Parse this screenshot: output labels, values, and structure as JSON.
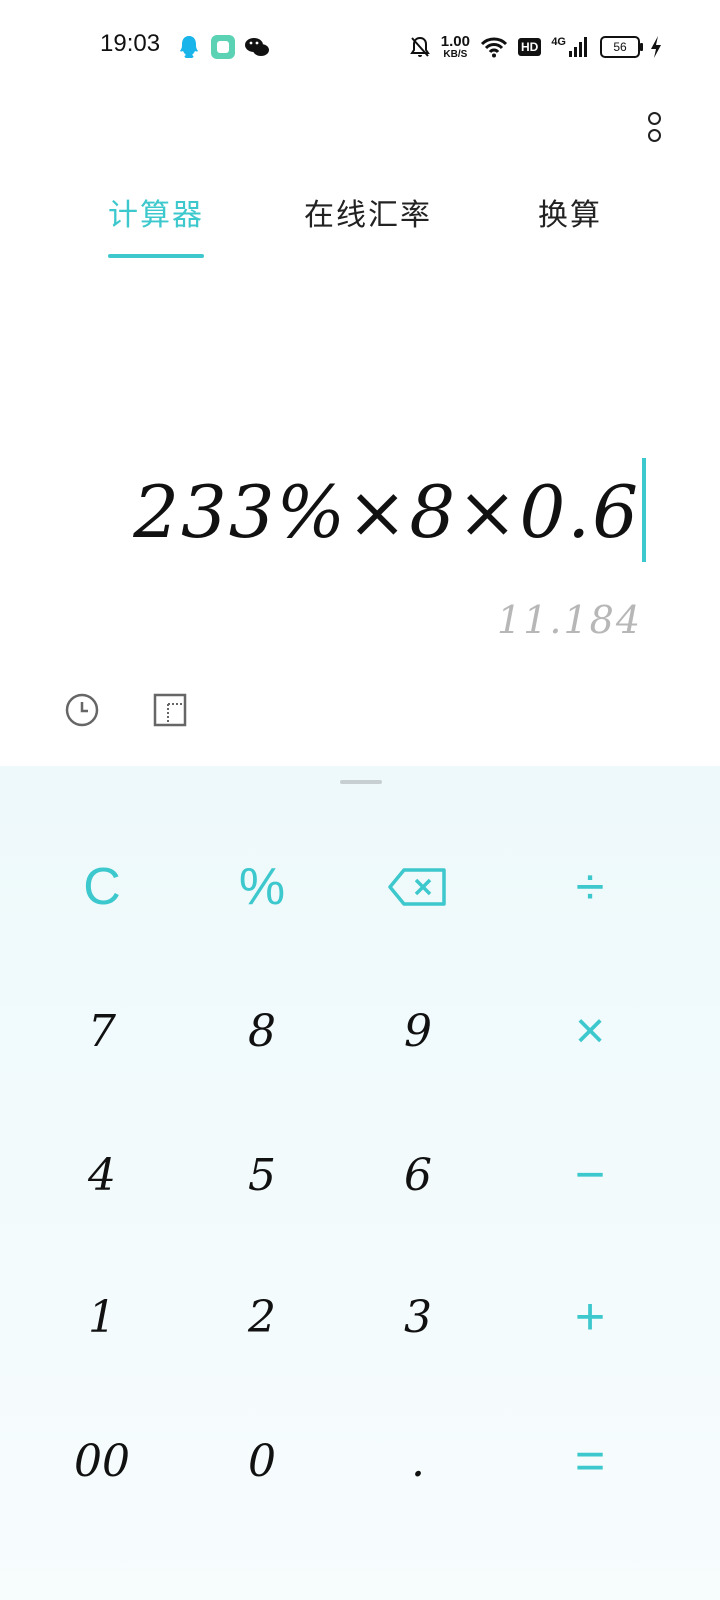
{
  "status_bar": {
    "time": "19:03",
    "network_speed_value": "1.00",
    "network_speed_unit": "KB/S",
    "hd_label": "HD",
    "network_type": "4G",
    "battery_level": "56"
  },
  "tabs": [
    {
      "label": "计算器",
      "active": true
    },
    {
      "label": "在线汇率",
      "active": false
    },
    {
      "label": "换算",
      "active": false
    }
  ],
  "display": {
    "expression": "233%×8×0.6",
    "result": "11.184"
  },
  "keypad": {
    "row1": [
      "C",
      "%",
      "⌫",
      "÷"
    ],
    "row2": [
      "7",
      "8",
      "9",
      "×"
    ],
    "row3": [
      "4",
      "5",
      "6",
      "−"
    ],
    "row4": [
      "1",
      "2",
      "3",
      "+"
    ],
    "row5": [
      "00",
      "0",
      ".",
      "="
    ]
  },
  "colors": {
    "accent": "#3cc8cc",
    "result_text": "#b7b7b7",
    "keypad_bg": "#eef9fb"
  },
  "icons": {
    "status_apps": [
      "qq-icon",
      "app-icon",
      "wechat-icon"
    ],
    "status_right": [
      "mute-bell-icon",
      "wifi-icon",
      "signal-icon",
      "battery-icon",
      "charging-icon"
    ],
    "tools": [
      "history-icon",
      "scientific-mode-icon"
    ],
    "menu": "more-vertical-icon"
  }
}
